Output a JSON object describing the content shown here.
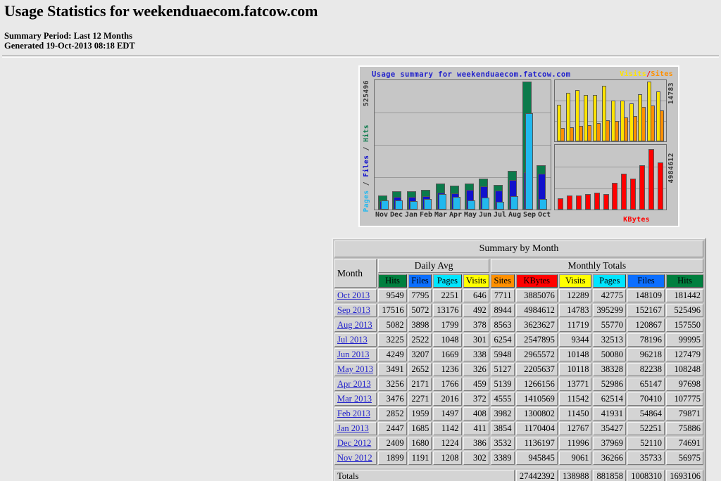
{
  "header": {
    "title": "Usage Statistics for weekenduaecom.fatcow.com",
    "summary_period": "Summary Period: Last 12 Months",
    "generated": "Generated 19-Oct-2013 08:18 EDT"
  },
  "chart": {
    "title": "Usage summary for weekenduaecom.fatcow.com",
    "legend_visits": "Visits",
    "legend_separator": "/",
    "legend_sites": "Sites",
    "legend_kbytes": "KBytes",
    "axis_left_max": "525496",
    "axis_left_label_pages": "Pages",
    "axis_left_label_sep1": " / ",
    "axis_left_label_files": "Files",
    "axis_left_label_sep2": " / ",
    "axis_left_label_hits": "Hits",
    "axis_right_top_max": "14783",
    "axis_right_bottom_max": "4984612"
  },
  "chart_data": {
    "type": "bar",
    "title": "Usage summary for weekenduaecom.fatcow.com",
    "xlabel": "",
    "ylabel": "Pages / Files / Hits",
    "categories": [
      "Nov",
      "Dec",
      "Jan",
      "Feb",
      "Mar",
      "Apr",
      "May",
      "Jun",
      "Jul",
      "Aug",
      "Sep",
      "Oct"
    ],
    "grid": true,
    "legend_position": "top-right",
    "panels": [
      {
        "name": "main",
        "ylim": [
          0,
          525496
        ],
        "ylabel": "Pages / Files / Hits",
        "series": [
          {
            "name": "Hits",
            "color": "#0b7a4b",
            "values": [
              56975,
              74691,
              75886,
              79871,
              107775,
              97698,
              108248,
              127479,
              99995,
              157550,
              525496,
              181442
            ]
          },
          {
            "name": "Files",
            "color": "#1111cc",
            "values": [
              35733,
              52110,
              52251,
              54864,
              70410,
              65147,
              82238,
              96218,
              78196,
              120867,
              152167,
              148109
            ]
          },
          {
            "name": "Pages",
            "color": "#22b8ee",
            "values": [
              36266,
              37969,
              35427,
              41931,
              62514,
              52986,
              38328,
              50080,
              32513,
              55770,
              395299,
              42775
            ]
          }
        ]
      },
      {
        "name": "visits-sites",
        "ylim": [
          0,
          14783
        ],
        "series": [
          {
            "name": "Visits",
            "color": "#ffe400",
            "values": [
              9061,
              11996,
              12767,
              11450,
              11542,
              13771,
              10118,
              10148,
              9344,
              11719,
              14783,
              12289
            ]
          },
          {
            "name": "Sites",
            "color": "#ff9000",
            "values": [
              3389,
              3532,
              3854,
              3982,
              4555,
              5139,
              5127,
              5948,
              6254,
              8563,
              8944,
              7711
            ]
          }
        ]
      },
      {
        "name": "kbytes",
        "ylim": [
          0,
          4984612
        ],
        "series": [
          {
            "name": "KBytes",
            "color": "#ff0000",
            "values": [
              945845,
              1136197,
              1170404,
              1300802,
              1410569,
              1266156,
              2205637,
              2965572,
              2547895,
              3623627,
              4984612,
              3885076
            ]
          }
        ]
      }
    ]
  },
  "table": {
    "title": "Summary by Month",
    "month_header": "Month",
    "group_daily": "Daily Avg",
    "group_monthly": "Monthly Totals",
    "daily_headers": [
      "Hits",
      "Files",
      "Pages",
      "Visits"
    ],
    "monthly_headers": [
      "Sites",
      "KBytes",
      "Visits",
      "Pages",
      "Files",
      "Hits"
    ],
    "rows": [
      {
        "month": "Oct 2013",
        "d_hits": "9549",
        "d_files": "7795",
        "d_pages": "2251",
        "d_visits": "646",
        "m_sites": "7711",
        "m_kbytes": "3885076",
        "m_visits": "12289",
        "m_pages": "42775",
        "m_files": "148109",
        "m_hits": "181442"
      },
      {
        "month": "Sep 2013",
        "d_hits": "17516",
        "d_files": "5072",
        "d_pages": "13176",
        "d_visits": "492",
        "m_sites": "8944",
        "m_kbytes": "4984612",
        "m_visits": "14783",
        "m_pages": "395299",
        "m_files": "152167",
        "m_hits": "525496"
      },
      {
        "month": "Aug 2013",
        "d_hits": "5082",
        "d_files": "3898",
        "d_pages": "1799",
        "d_visits": "378",
        "m_sites": "8563",
        "m_kbytes": "3623627",
        "m_visits": "11719",
        "m_pages": "55770",
        "m_files": "120867",
        "m_hits": "157550"
      },
      {
        "month": "Jul 2013",
        "d_hits": "3225",
        "d_files": "2522",
        "d_pages": "1048",
        "d_visits": "301",
        "m_sites": "6254",
        "m_kbytes": "2547895",
        "m_visits": "9344",
        "m_pages": "32513",
        "m_files": "78196",
        "m_hits": "99995"
      },
      {
        "month": "Jun 2013",
        "d_hits": "4249",
        "d_files": "3207",
        "d_pages": "1669",
        "d_visits": "338",
        "m_sites": "5948",
        "m_kbytes": "2965572",
        "m_visits": "10148",
        "m_pages": "50080",
        "m_files": "96218",
        "m_hits": "127479"
      },
      {
        "month": "May 2013",
        "d_hits": "3491",
        "d_files": "2652",
        "d_pages": "1236",
        "d_visits": "326",
        "m_sites": "5127",
        "m_kbytes": "2205637",
        "m_visits": "10118",
        "m_pages": "38328",
        "m_files": "82238",
        "m_hits": "108248"
      },
      {
        "month": "Apr 2013",
        "d_hits": "3256",
        "d_files": "2171",
        "d_pages": "1766",
        "d_visits": "459",
        "m_sites": "5139",
        "m_kbytes": "1266156",
        "m_visits": "13771",
        "m_pages": "52986",
        "m_files": "65147",
        "m_hits": "97698"
      },
      {
        "month": "Mar 2013",
        "d_hits": "3476",
        "d_files": "2271",
        "d_pages": "2016",
        "d_visits": "372",
        "m_sites": "4555",
        "m_kbytes": "1410569",
        "m_visits": "11542",
        "m_pages": "62514",
        "m_files": "70410",
        "m_hits": "107775"
      },
      {
        "month": "Feb 2013",
        "d_hits": "2852",
        "d_files": "1959",
        "d_pages": "1497",
        "d_visits": "408",
        "m_sites": "3982",
        "m_kbytes": "1300802",
        "m_visits": "11450",
        "m_pages": "41931",
        "m_files": "54864",
        "m_hits": "79871"
      },
      {
        "month": "Jan 2013",
        "d_hits": "2447",
        "d_files": "1685",
        "d_pages": "1142",
        "d_visits": "411",
        "m_sites": "3854",
        "m_kbytes": "1170404",
        "m_visits": "12767",
        "m_pages": "35427",
        "m_files": "52251",
        "m_hits": "75886"
      },
      {
        "month": "Dec 2012",
        "d_hits": "2409",
        "d_files": "1680",
        "d_pages": "1224",
        "d_visits": "386",
        "m_sites": "3532",
        "m_kbytes": "1136197",
        "m_visits": "11996",
        "m_pages": "37969",
        "m_files": "52110",
        "m_hits": "74691"
      },
      {
        "month": "Nov 2012",
        "d_hits": "1899",
        "d_files": "1191",
        "d_pages": "1208",
        "d_visits": "302",
        "m_sites": "3389",
        "m_kbytes": "945845",
        "m_visits": "9061",
        "m_pages": "36266",
        "m_files": "35733",
        "m_hits": "56975"
      }
    ],
    "totals": {
      "label": "Totals",
      "kbytes": "27442392",
      "visits": "138988",
      "pages": "881858",
      "files": "1008310",
      "hits": "1693106"
    }
  }
}
